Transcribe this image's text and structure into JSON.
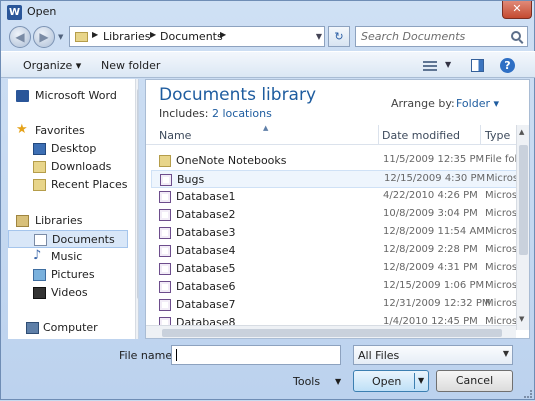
{
  "window": {
    "title": "Open",
    "app_icon": "W",
    "close_label": "✕"
  },
  "nav": {
    "breadcrumbs": [
      "Libraries",
      "Documents"
    ],
    "search_placeholder": "Search Documents"
  },
  "toolbar": {
    "organize": "Organize ▾",
    "new_folder": "New folder"
  },
  "sidebar": {
    "items": [
      {
        "label": "Microsoft Word",
        "icon": "word-icon"
      },
      {
        "label": "Favorites",
        "icon": "star-icon"
      },
      {
        "label": "Desktop",
        "icon": "desktop-icon"
      },
      {
        "label": "Downloads",
        "icon": "downloads-icon"
      },
      {
        "label": "Recent Places",
        "icon": "recent-places-icon"
      },
      {
        "label": "Libraries",
        "icon": "libraries-icon"
      },
      {
        "label": "Documents",
        "icon": "documents-icon"
      },
      {
        "label": "Music",
        "icon": "music-icon"
      },
      {
        "label": "Pictures",
        "icon": "pictures-icon"
      },
      {
        "label": "Videos",
        "icon": "videos-icon"
      },
      {
        "label": "Computer",
        "icon": "computer-icon"
      }
    ]
  },
  "content": {
    "title": "Documents library",
    "includes_label": "Includes:",
    "includes_link": "2 locations",
    "arrange_label": "Arrange by:",
    "arrange_value": "Folder ▾",
    "columns": [
      "Name",
      "Date modified",
      "Type"
    ],
    "rows": [
      {
        "name": "OneNote Notebooks",
        "date": "11/5/2009 12:35 PM",
        "type": "File fol"
      },
      {
        "name": "Bugs",
        "date": "12/15/2009 4:30 PM",
        "type": "Micros"
      },
      {
        "name": "Database1",
        "date": "4/22/2010 4:26 PM",
        "type": "Micros"
      },
      {
        "name": "Database2",
        "date": "10/8/2009 3:04 PM",
        "type": "Micros"
      },
      {
        "name": "Database3",
        "date": "12/8/2009 11:54 AM",
        "type": "Micros"
      },
      {
        "name": "Database4",
        "date": "12/8/2009 2:28 PM",
        "type": "Micros"
      },
      {
        "name": "Database5",
        "date": "12/8/2009 4:31 PM",
        "type": "Micros"
      },
      {
        "name": "Database6",
        "date": "12/15/2009 1:06 PM",
        "type": "Micros"
      },
      {
        "name": "Database7",
        "date": "12/31/2009 12:32 PM",
        "type": "Micros"
      },
      {
        "name": "Database8",
        "date": "1/4/2010 12:45 PM",
        "type": "Micros"
      }
    ]
  },
  "footer": {
    "file_name_label": "File name:",
    "file_name_value": "",
    "file_type": "All Files",
    "tools": "Tools",
    "open": "Open",
    "cancel": "Cancel"
  }
}
